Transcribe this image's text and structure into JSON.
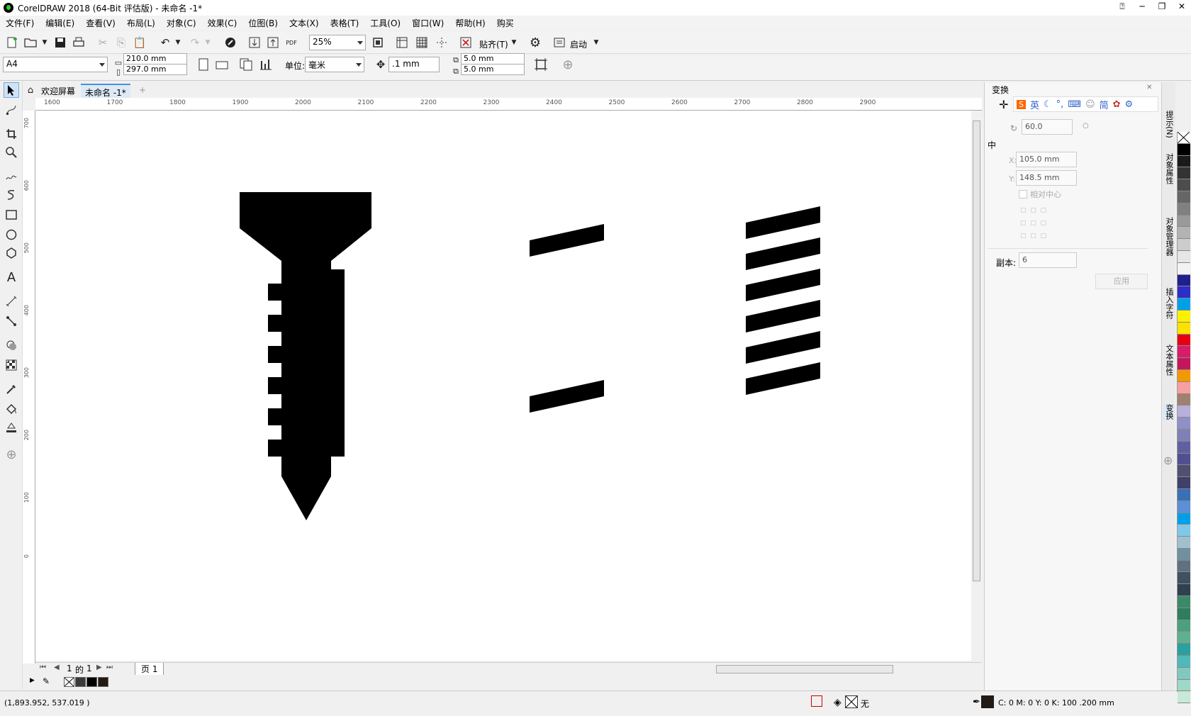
{
  "window": {
    "title": "CorelDRAW 2018 (64-Bit 评估版) - 未命名 -1*"
  },
  "menu": [
    "文件(F)",
    "编辑(E)",
    "查看(V)",
    "布局(L)",
    "对象(C)",
    "效果(C)",
    "位图(B)",
    "文本(X)",
    "表格(T)",
    "工具(O)",
    "窗口(W)",
    "帮助(H)",
    "购买"
  ],
  "toolbar": {
    "zoom": "25%",
    "snap_label": "贴齐(T)",
    "launch_label": "启动",
    "pdf_label": "PDF"
  },
  "property_bar": {
    "page_size": "A4",
    "width": "210.0 mm",
    "height": "297.0 mm",
    "units_label": "单位:",
    "units": "毫米",
    "nudge": ".1 mm",
    "dup_x": "5.0 mm",
    "dup_y": "5.0 mm"
  },
  "tabs": {
    "welcome": "欢迎屏幕",
    "doc": "未命名 -1*"
  },
  "ruler_h": [
    "1600",
    "1700",
    "1800",
    "1900",
    "2000",
    "2100",
    "2200",
    "2300",
    "2400",
    "2500",
    "2600",
    "2700",
    "2800",
    "2900"
  ],
  "ruler_v": [
    "700",
    "600",
    "500",
    "400",
    "300",
    "200",
    "100",
    "0"
  ],
  "page_nav": {
    "pos": "1",
    "of_label": "的",
    "total": "1",
    "page_tab": "页 1"
  },
  "docker": {
    "title": "变换",
    "angle": "60.0",
    "center_label": "中",
    "x_label": "X:",
    "x": "105.0 mm",
    "y_label": "Y:",
    "y": "148.5 mm",
    "relative_center": "相对中心",
    "copies_label": "副本:",
    "copies": "6",
    "apply_label": "应用",
    "ime": [
      "英",
      "简"
    ],
    "tabs": [
      "提示(N)",
      "对象属性",
      "对象管理器",
      "插入字符",
      "文本属性",
      "变换"
    ]
  },
  "status": {
    "coords": "(1,893.952, 537.019 )",
    "fill_none": "无",
    "outline": "C: 0 M: 0 Y: 0 K: 100  .200 mm"
  },
  "palette": [
    "#ffffff",
    "#000000",
    "#1a1a1a",
    "#333333",
    "#4d4d4d",
    "#666666",
    "#808080",
    "#999999",
    "#b3b3b3",
    "#cccccc",
    "#e6e6e6",
    "#f2f2f2",
    "#1f1f8f",
    "#2d2dc8",
    "#00a0e9",
    "#fff200",
    "#ffe100",
    "#e60012",
    "#d81c6b",
    "#c2185b",
    "#f39800",
    "#f6a0a0",
    "#a08070",
    "#b8b0d8",
    "#9090c8",
    "#8080b8",
    "#6060a0",
    "#505090",
    "#505070",
    "#40406a",
    "#3b6fb6",
    "#5b8fd6",
    "#00a0e9",
    "#80c8e8",
    "#a0c0d0",
    "#7090a0",
    "#607080",
    "#405060",
    "#304050",
    "#3a8a6a",
    "#2e7d5b",
    "#4aa080",
    "#60b090",
    "#2aa0a0",
    "#50b8b8",
    "#80c8c0",
    "#a0d8c8",
    "#c8e8d8"
  ],
  "swatches": [
    "#ffffff",
    "#3a3a3a",
    "#000000",
    "#221a14"
  ]
}
